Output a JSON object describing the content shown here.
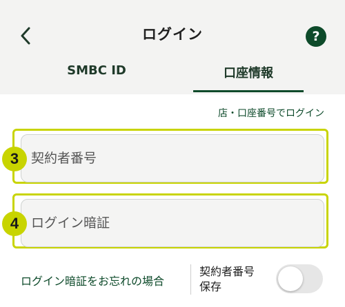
{
  "header": {
    "title": "ログイン",
    "back_icon": "chevron-left",
    "help_label": "?"
  },
  "tabs": [
    {
      "label": "SMBC ID",
      "active": false
    },
    {
      "label": "口座情報",
      "active": true
    }
  ],
  "store_login_link": "店・口座番号でログイン",
  "fields": {
    "contract_number": {
      "placeholder": "契約者番号",
      "value": "",
      "badge": "3"
    },
    "login_password": {
      "placeholder": "ログイン暗証",
      "value": "",
      "badge": "4"
    }
  },
  "forgot_link": "ログイン暗証をお忘れの場合",
  "save_toggle": {
    "label_line1": "契約者番号",
    "label_line2": "保存",
    "on": false
  },
  "colors": {
    "brand_green": "#0d4a2a",
    "highlight_yellow": "#c8d400",
    "header_bg": "#f3f3f2"
  }
}
